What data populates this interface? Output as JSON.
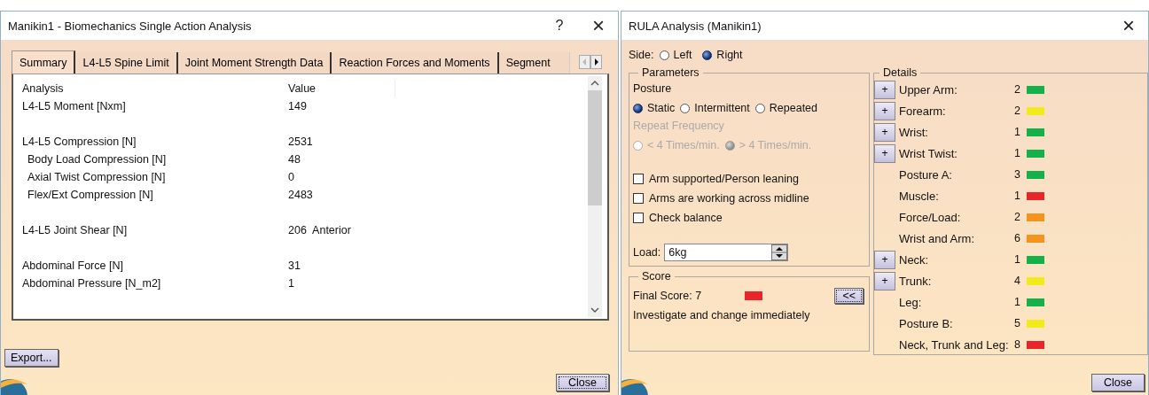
{
  "analysis_window": {
    "title": "Manikin1 - Biomechanics Single Action Analysis",
    "help": "?",
    "close": "×",
    "tabs": [
      {
        "label": "Summary",
        "selected": true
      },
      {
        "label": "L4-L5 Spine Limit",
        "selected": false
      },
      {
        "label": "Joint Moment Strength Data",
        "selected": false
      },
      {
        "label": "Reaction Forces and Moments",
        "selected": false
      },
      {
        "label": "Segment",
        "selected": false
      }
    ],
    "table": {
      "columns": [
        "Analysis",
        "Value"
      ],
      "rows": [
        {
          "kind": "data",
          "analysis": "L4-L5 Moment [Nxm]",
          "value": "149",
          "indented": false
        },
        {
          "kind": "gap"
        },
        {
          "kind": "data",
          "analysis": "L4-L5 Compression [N]",
          "value": "2531",
          "indented": false
        },
        {
          "kind": "data",
          "analysis": "Body Load Compression [N]",
          "value": "48",
          "indented": true
        },
        {
          "kind": "data",
          "analysis": "Axial Twist Compression [N]",
          "value": "0",
          "indented": true
        },
        {
          "kind": "data",
          "analysis": "Flex/Ext Compression [N]",
          "value": "2483",
          "indented": true
        },
        {
          "kind": "gap"
        },
        {
          "kind": "data",
          "analysis": "L4-L5 Joint Shear [N]",
          "value": "206  Anterior",
          "indented": false
        },
        {
          "kind": "gap"
        },
        {
          "kind": "data",
          "analysis": "Abdominal Force [N]",
          "value": "31",
          "indented": false
        },
        {
          "kind": "data",
          "analysis": "Abdominal Pressure [N_m2]",
          "value": "1",
          "indented": false
        }
      ]
    },
    "buttons": [
      "Export...",
      "Close"
    ]
  },
  "rula_window": {
    "title": "RULA Analysis (Manikin1)",
    "close": "×",
    "side": {
      "label": "Side:",
      "options": [
        {
          "label": "Left",
          "selected": false
        },
        {
          "label": "Right",
          "selected": true
        }
      ]
    },
    "parameters": {
      "title": "Parameters",
      "posture_label": "Posture",
      "posture": [
        {
          "label": "Static",
          "selected": true
        },
        {
          "label": "Intermittent",
          "selected": false
        },
        {
          "label": "Repeated",
          "selected": false
        }
      ],
      "frequency_label": "Repeat Frequency",
      "frequency_disabled": true,
      "frequency": [
        {
          "label": "< 4 Times/min.",
          "selected": false
        },
        {
          "label": "> 4 Times/min.",
          "selected": true
        }
      ],
      "checkboxes": [
        {
          "label": "Arm supported/Person leaning",
          "checked": false
        },
        {
          "label": "Arms are working across midline",
          "checked": false
        },
        {
          "label": "Check balance",
          "checked": false
        }
      ],
      "load_label": "Load:",
      "load_value": "6kg"
    },
    "score": {
      "title": "Score",
      "final_score": "Final Score: 7",
      "color": "#e8262a",
      "message": "Investigate and change immediately",
      "collapse": "<<"
    },
    "details": {
      "title": "Details",
      "rows": [
        {
          "label": "Upper Arm:",
          "value": "2",
          "color": "#16b04a",
          "expand_button": "+"
        },
        {
          "label": "Forearm:",
          "value": "2",
          "color": "#f2ea1c",
          "expand_button": "+"
        },
        {
          "label": "Wrist:",
          "value": "1",
          "color": "#16b04a",
          "expand_button": "+"
        },
        {
          "label": "Wrist Twist:",
          "value": "1",
          "color": "#16b04a",
          "expand_button": "+"
        },
        {
          "label": "Posture A:",
          "value": "3",
          "color": "#16b04a"
        },
        {
          "label": "Muscle:",
          "value": "1",
          "color": "#e8262a"
        },
        {
          "label": "Force/Load:",
          "value": "2",
          "color": "#f5931f"
        },
        {
          "label": "Wrist and Arm:",
          "value": "6",
          "color": "#f5931f"
        },
        {
          "label": "Neck:",
          "value": "1",
          "color": "#16b04a",
          "expand_button": "+"
        },
        {
          "label": "Trunk:",
          "value": "4",
          "color": "#f2ea1c",
          "expand_button": "+"
        },
        {
          "label": "Leg:",
          "value": "1",
          "color": "#16b04a"
        },
        {
          "label": "Posture B:",
          "value": "5",
          "color": "#f2ea1c"
        },
        {
          "label": "Neck, Trunk and Leg:",
          "value": "8",
          "color": "#e8262a"
        }
      ]
    },
    "close_button": "Close"
  }
}
